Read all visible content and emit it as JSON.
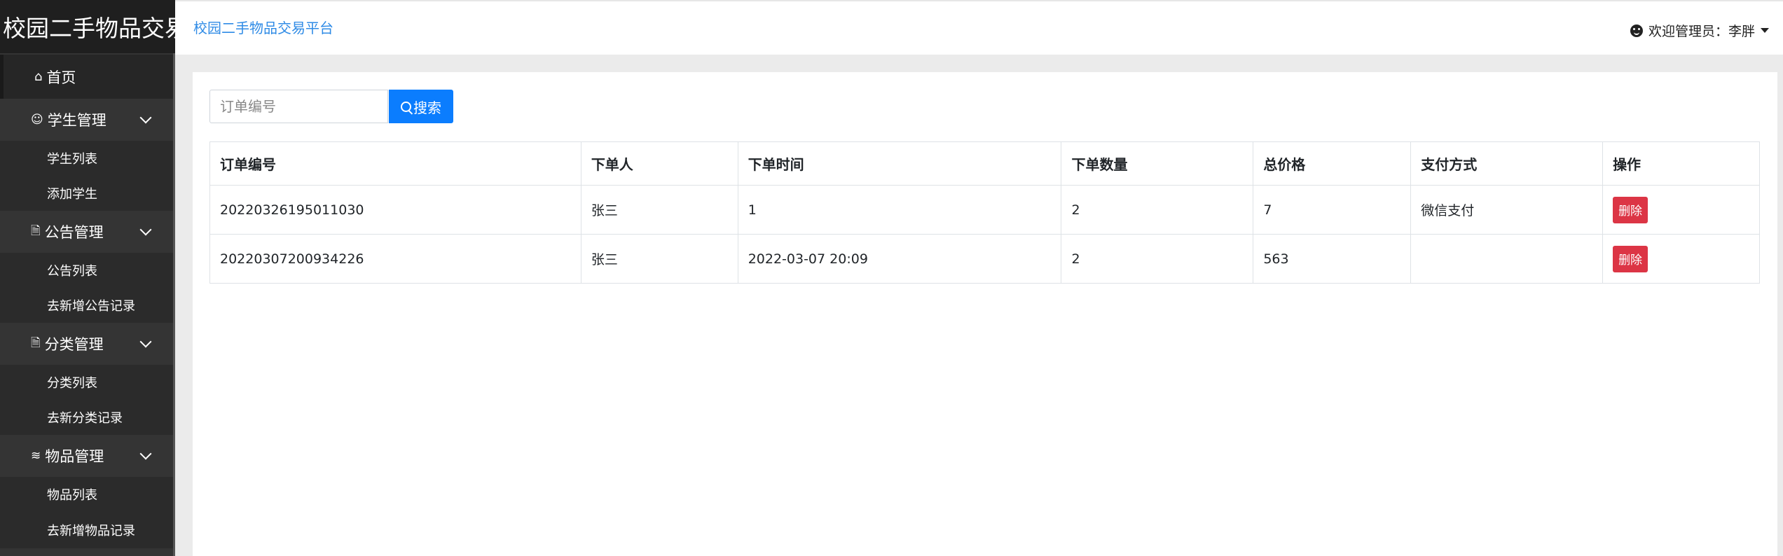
{
  "brand": "校园二手物品交易",
  "header": {
    "title": "校园二手物品交易平台",
    "user_label": "欢迎管理员：李胖"
  },
  "sidebar": {
    "home": "首页",
    "groups": [
      {
        "label": "学生管理",
        "icon": "user-circle-icon",
        "items": [
          "学生列表",
          "添加学生"
        ]
      },
      {
        "label": "公告管理",
        "icon": "document-icon",
        "items": [
          "公告列表",
          "去新增公告记录"
        ]
      },
      {
        "label": "分类管理",
        "icon": "document-icon",
        "items": [
          "分类列表",
          "去新分类记录"
        ]
      },
      {
        "label": "物品管理",
        "icon": "layers-icon",
        "items": [
          "物品列表",
          "去新增物品记录"
        ]
      }
    ]
  },
  "search": {
    "placeholder": "订单编号",
    "button_label": "搜索"
  },
  "table": {
    "columns": [
      "订单编号",
      "下单人",
      "下单时间",
      "下单数量",
      "总价格",
      "支付方式",
      "操作"
    ],
    "rows": [
      [
        "20220326195011030",
        "张三",
        "1",
        "2",
        "7",
        "微信支付"
      ],
      [
        "20220307200934226",
        "张三",
        "2022-03-07 20:09",
        "2",
        "563",
        ""
      ]
    ],
    "delete_label": "删除"
  }
}
